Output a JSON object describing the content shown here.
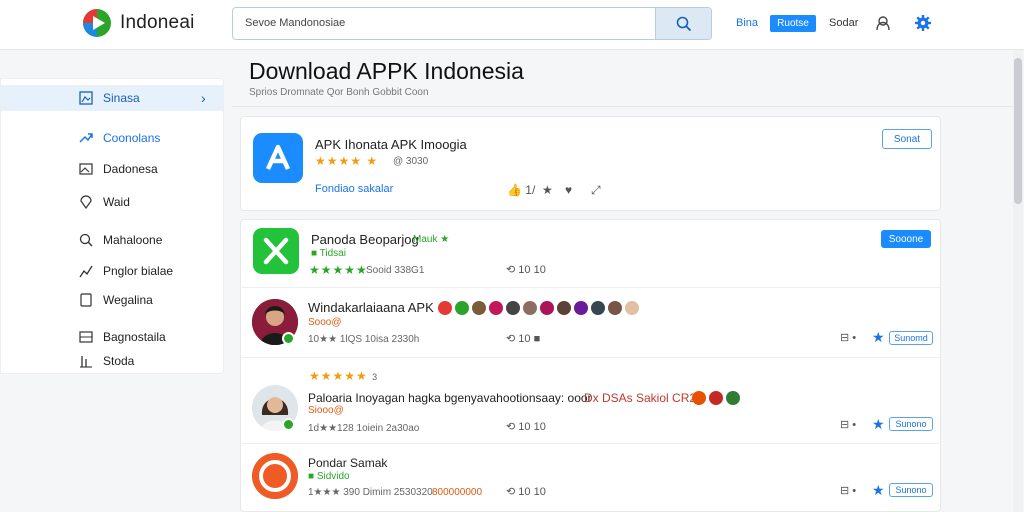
{
  "header": {
    "brand": "Indoneai",
    "search_text": "Sevoe  Mandonosiae",
    "link_blue": "Bina",
    "button": "Ruotse",
    "link_gray": "Sodar"
  },
  "sidebar": {
    "items": [
      {
        "label": "Sinasa",
        "icon": "image-icon",
        "active": true
      },
      {
        "label": "Coonolans",
        "icon": "trending-icon",
        "blue": true
      },
      {
        "label": "Dadonesa",
        "icon": "photo-icon"
      },
      {
        "label": "Waid",
        "icon": "location-icon"
      },
      {
        "label": "Mahaloone",
        "icon": "search-icon"
      },
      {
        "label": "Pnglor bialae",
        "icon": "chart-icon"
      },
      {
        "label": "Wegalina",
        "icon": "bookmark-icon"
      },
      {
        "label": "Bagnostaila",
        "icon": "grid-icon"
      },
      {
        "label": "Stoda",
        "icon": "stats-icon"
      }
    ]
  },
  "main": {
    "title": "Download APPK Indonesia",
    "breadcrumb": "Sprios Dromnate  Qor Bonh   Gobbit Coon"
  },
  "featured": {
    "title": "APK Ihonata APK Imoogia",
    "stars": "★★★★ ★",
    "rating_text": "@ 3030",
    "link": "Fondiao sakalar",
    "button": "Sonat",
    "actions": [
      "👍 1/",
      "★",
      "♥",
      "⤢"
    ]
  },
  "apps": [
    {
      "title": "Panoda Beoparjog",
      "tag": "Mauk ★",
      "sub_tag": "■ Tidsai",
      "stars": "★★★★★",
      "meta": "Sooid 338G1",
      "count": "10  10",
      "button": "Sooone"
    },
    {
      "title": "Windakarlaiaana APK",
      "orange": "Sooo@",
      "meta": "10★★ 1lQS  10isa 2330h",
      "count": "10  ■",
      "right_label": "Sunomd",
      "right_icon": "⊟ •"
    },
    {
      "title": "Paloaria Inoyagan hagka bgenyavahootionsaay: ooor",
      "title_tail": "Dx DSAs  Sakiol CR2",
      "orange": "Siooo@",
      "stars": "★★★★★",
      "star_num": "3",
      "meta": "1d★★128  1oiein 2a30ao",
      "count": "10  10",
      "right_label": "Sunono",
      "right_icon": "⊟ •"
    },
    {
      "title": "Pondar Samak",
      "sub_tag": "■ Sidvido",
      "meta": "1★★★ 390  Dimim 2530320",
      "orange": "800000000",
      "count": "10  10",
      "right_label": "Sunono",
      "right_icon": "⊟ •"
    }
  ],
  "colors": {
    "accent": "#1a8cff",
    "star": "#f39c12",
    "green": "#2aa52a",
    "orange": "#e05a10"
  }
}
